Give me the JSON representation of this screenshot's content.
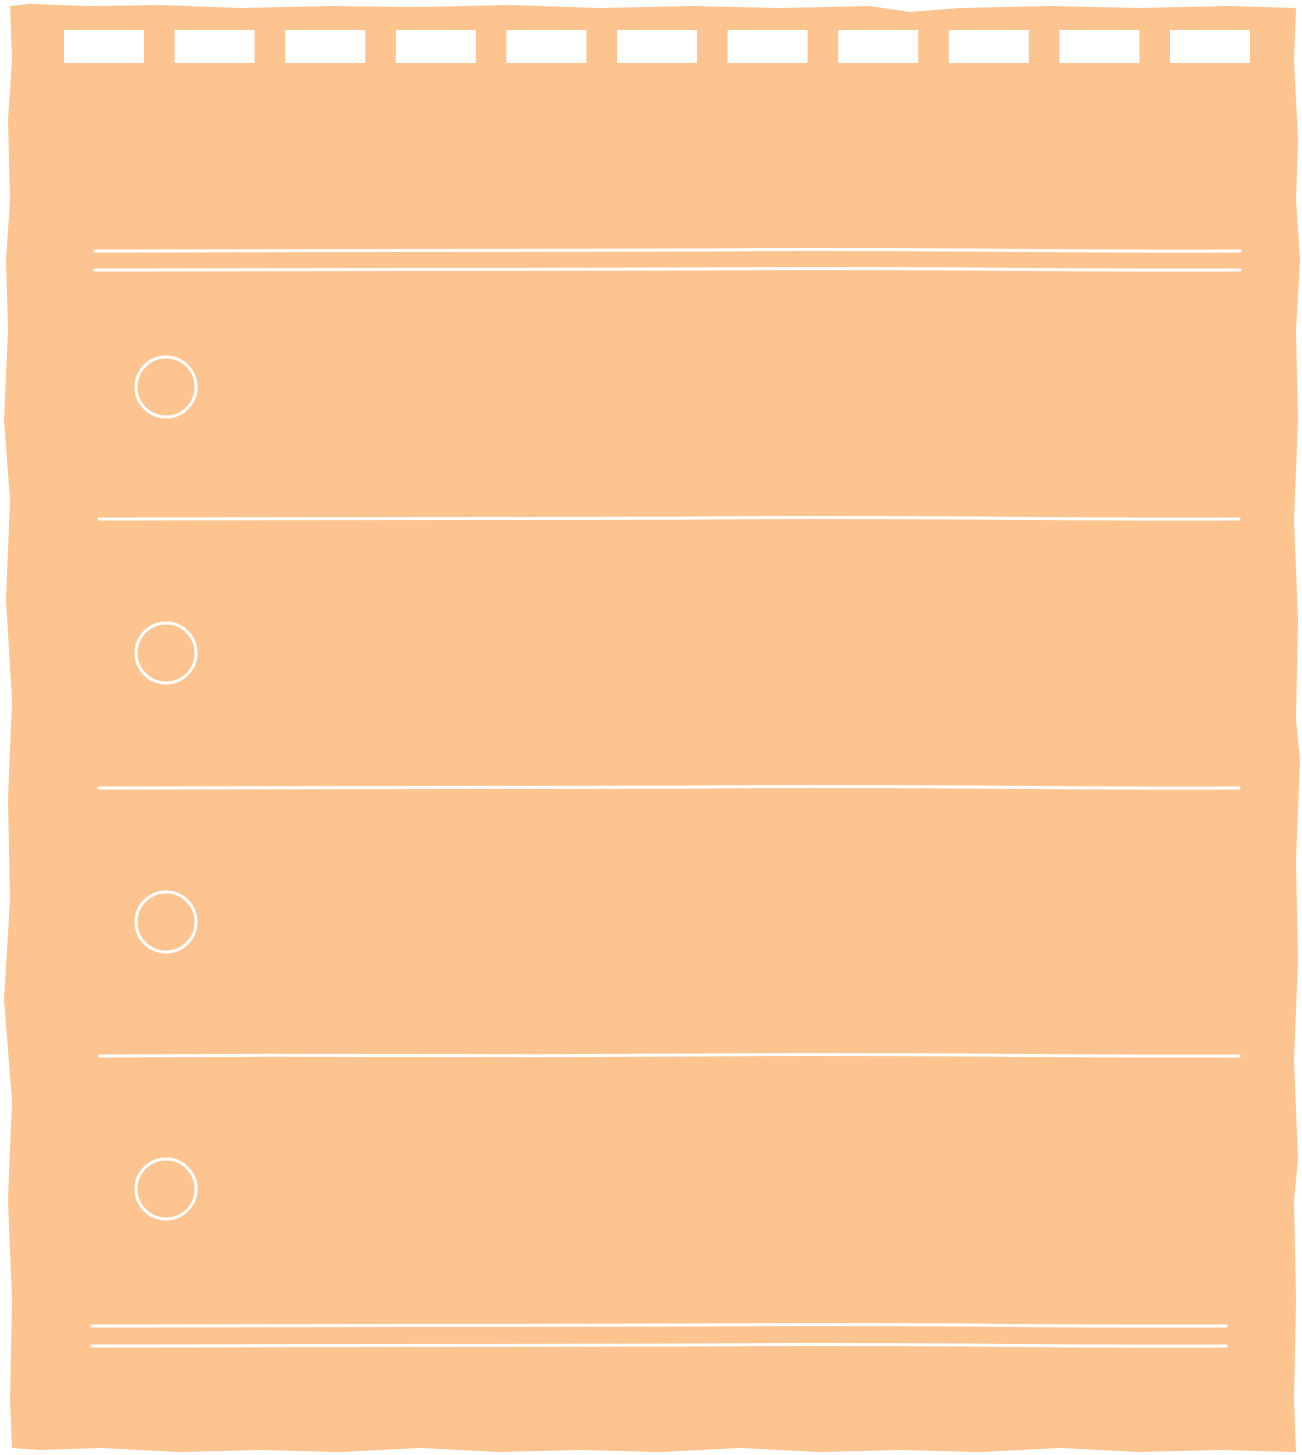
{
  "sheet": {
    "paper_color": "#FEC48F",
    "line_color": "#FFFFFF",
    "binding_holes": 11,
    "checklist": {
      "items": [
        {
          "text": ""
        },
        {
          "text": ""
        },
        {
          "text": ""
        },
        {
          "text": ""
        }
      ]
    }
  }
}
